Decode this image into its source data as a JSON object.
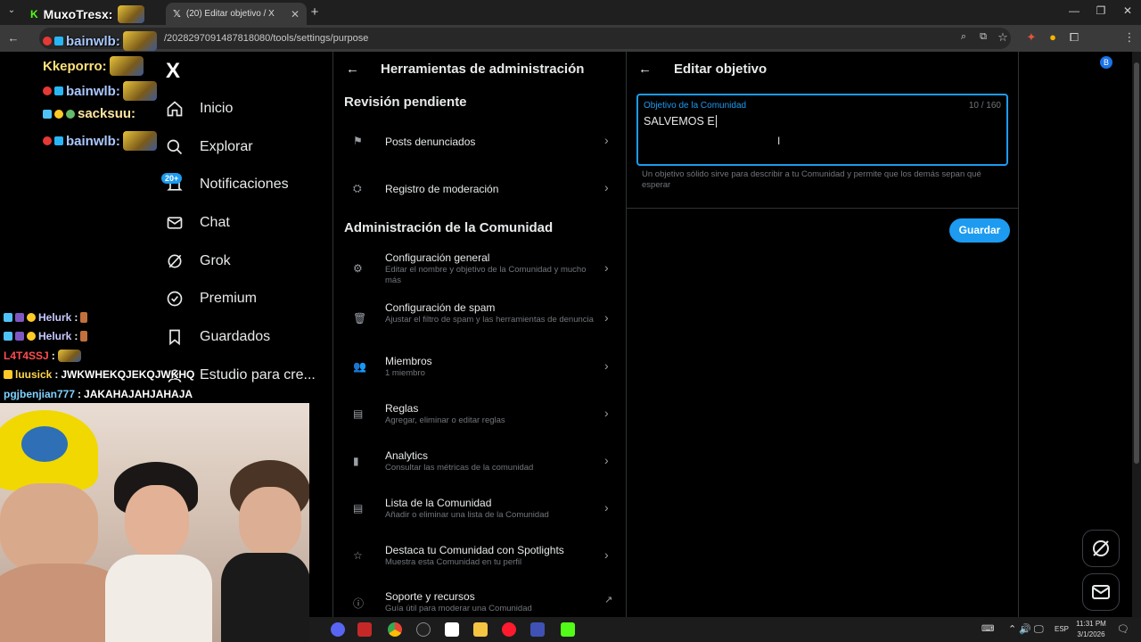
{
  "browser": {
    "tab1_title": "MuxoTresx:",
    "tab2_title": "(20) Editar objetivo / X",
    "url": "/2028297091487818080/tools/settings/purpose",
    "new_tab": "+"
  },
  "overlay": {
    "top_chat": [
      {
        "name": "MuxoTresx:"
      },
      {
        "name": "bainwlb:"
      },
      {
        "name": "Kkeporro:"
      },
      {
        "name": "bainwlb:"
      },
      {
        "name": "sacksuu:"
      },
      {
        "name": "bainwlb:"
      }
    ],
    "bottom_chat": [
      {
        "name": "Helurk",
        "sep": ":",
        "msg": ""
      },
      {
        "name": "Helurk",
        "sep": ":",
        "msg": ""
      },
      {
        "name": "L4T4SSJ",
        "sep": ":",
        "msg": ""
      },
      {
        "name": "luusick",
        "sep": ":",
        "msg": "JWKWHEKQJEKQJWKHQ"
      },
      {
        "name": "pgjbenjian777",
        "sep": ":",
        "msg": "JAKAHAJAHJAHAJA"
      }
    ]
  },
  "sidebar": {
    "logo": "X",
    "items": [
      {
        "label": "Inicio",
        "icon": "home-icon"
      },
      {
        "label": "Explorar",
        "icon": "search-icon"
      },
      {
        "label": "Notificaciones",
        "icon": "bell-icon",
        "badge": "20+"
      },
      {
        "label": "Chat",
        "icon": "mail-icon"
      },
      {
        "label": "Grok",
        "icon": "grok-icon"
      },
      {
        "label": "Premium",
        "icon": "premium-icon"
      },
      {
        "label": "Guardados",
        "icon": "bookmark-icon"
      },
      {
        "label": "Estudio para cre...",
        "icon": "studio-icon"
      }
    ]
  },
  "middle": {
    "header": "Herramientas de administración",
    "section1": "Revisión pendiente",
    "section2": "Administración de la Comunidad",
    "items": [
      {
        "title": "Posts denunciados",
        "sub": ""
      },
      {
        "title": "Registro de moderación",
        "sub": ""
      },
      {
        "title": "Configuración general",
        "sub": "Editar el nombre y objetivo de la Comunidad y mucho más"
      },
      {
        "title": "Configuración de spam",
        "sub": "Ajustar el filtro de spam y las herramientas de denuncia"
      },
      {
        "title": "Miembros",
        "sub": "1 miembro"
      },
      {
        "title": "Reglas",
        "sub": "Agregar, eliminar o editar reglas"
      },
      {
        "title": "Analytics",
        "sub": "Consultar las métricas de la comunidad"
      },
      {
        "title": "Lista de la Comunidad",
        "sub": "Añadir o eliminar una lista de la Comunidad"
      },
      {
        "title": "Destaca tu Comunidad con Spotlights",
        "sub": "Muestra esta Comunidad en tu perfil"
      },
      {
        "title": "Soporte y recursos",
        "sub": "Guía útil para moderar una Comunidad"
      }
    ]
  },
  "right": {
    "header": "Editar objetivo",
    "field_label": "Objetivo de la Comunidad",
    "counter": "10 / 160",
    "field_value": "SALVEMOS E",
    "helper": "Un objetivo sólido sirve para describir a tu Comunidad y permite que los demás sepan qué esperar",
    "save_label": "Guardar"
  },
  "taskbar": {
    "lang": "ESP",
    "time": "11:31 PM",
    "date": "3/1/2026"
  },
  "colors": {
    "accent": "#1d9bf0",
    "border": "#2f3336",
    "secondary_text": "#71767b"
  }
}
